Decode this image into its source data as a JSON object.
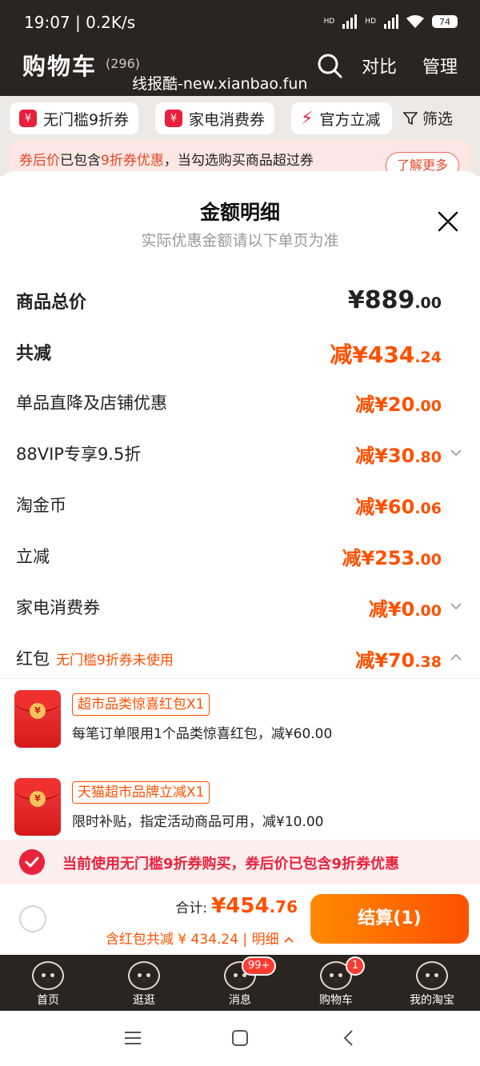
{
  "status_bar": {
    "time": "19:07 | 0.2K/s",
    "signal1": "HD",
    "signal2": "HD",
    "battery": "74"
  },
  "header": {
    "title": "购物车",
    "count": "(296)",
    "compare": "对比",
    "manage": "管理",
    "watermark": "线报酷-new.xianbao.fun"
  },
  "filters": {
    "chip1": "无门槛9折券",
    "chip2": "家电消费券",
    "chip3": "官方立减",
    "filter": "筛选",
    "tag_icon": "¥"
  },
  "banner": {
    "part1": "券后价",
    "part2": "已包含",
    "part3": "9折券优惠",
    "part4": "，当勾选购买商品超过券",
    "more": "了解更多"
  },
  "sheet": {
    "title": "金额明细",
    "subtitle": "实际优惠金额请以下单页为准",
    "rows": [
      {
        "label": "商品总价",
        "amount_main": "¥889",
        "amount_dec": ".00"
      },
      {
        "label": "共减",
        "amount_main": "减¥434",
        "amount_dec": ".24"
      },
      {
        "label": "单品直降及店铺优惠",
        "amount_main": "减¥20",
        "amount_dec": ".00"
      },
      {
        "label": "88VIP专享9.5折",
        "amount_main": "减¥30",
        "amount_dec": ".80"
      },
      {
        "label": "淘金币",
        "amount_main": "减¥60",
        "amount_dec": ".06"
      },
      {
        "label": "立减",
        "amount_main": "减¥253",
        "amount_dec": ".00"
      },
      {
        "label": "家电消费券",
        "amount_main": "减¥0",
        "amount_dec": ".00"
      },
      {
        "label": "红包",
        "note": "无门槛9折券未使用",
        "amount_main": "减¥70",
        "amount_dec": ".38"
      }
    ],
    "red_packets": [
      {
        "tag": "超市品类惊喜红包X1",
        "desc": "每笔订单限用1个品类惊喜红包，减¥60.00",
        "coin": "¥"
      },
      {
        "tag": "天猫超市品牌立减X1",
        "desc": "限时补贴，指定活动商品可用，减¥10.00",
        "coin": "¥"
      }
    ],
    "notice": "当前使用无门槛9折券购买，券后价已包含9折券优惠"
  },
  "checkout": {
    "total_label": "合计:",
    "total_main": "¥454",
    "total_dec": ".76",
    "sub": "含红包共减 ¥ 434.24 | 明细",
    "pay_button": "结算(1)"
  },
  "tabbar": {
    "items": [
      {
        "label": "首页"
      },
      {
        "label": "逛逛"
      },
      {
        "label": "消息",
        "badge": "99+"
      },
      {
        "label": "购物车",
        "badge": "1"
      },
      {
        "label": "我的淘宝"
      }
    ]
  },
  "colors": {
    "accent": "#ff5000",
    "brand_red": "#e9233e",
    "dark_bg": "#2b2522"
  }
}
